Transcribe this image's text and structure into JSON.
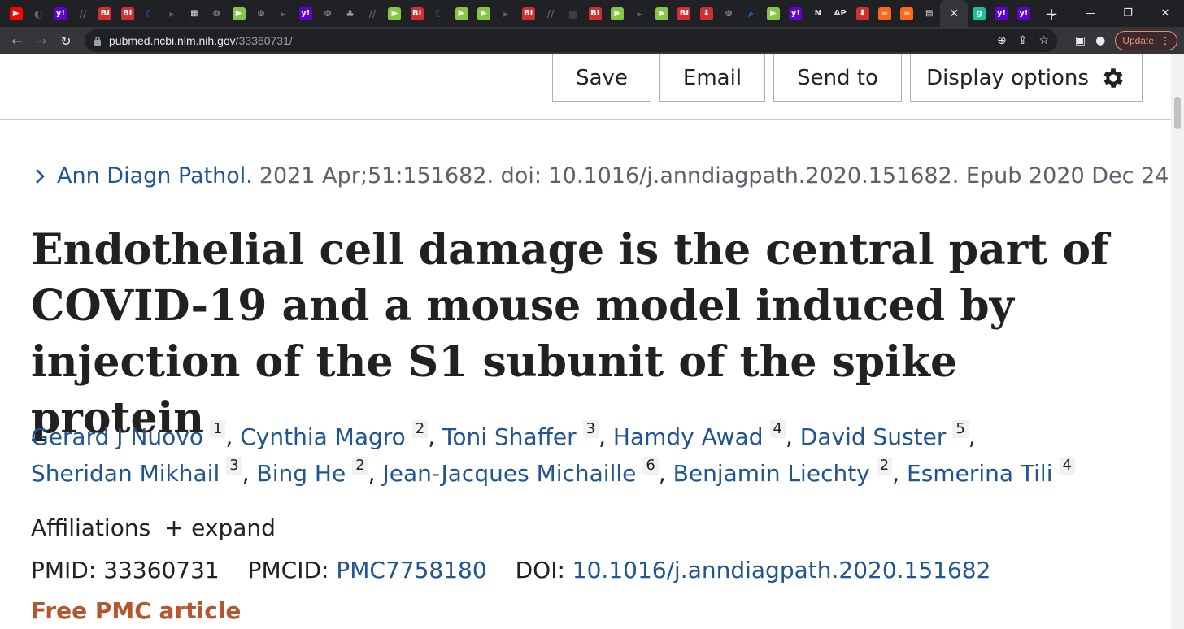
{
  "browser": {
    "tab_favicons": [
      {
        "name": "youtube-icon",
        "color": "#ff0000",
        "glyph": "▶"
      },
      {
        "name": "shield-icon",
        "color": "#5f6368",
        "glyph": "◐"
      },
      {
        "name": "yahoo-icon",
        "color": "#6001d2",
        "glyph": "y!"
      },
      {
        "name": "slashes-icon",
        "color": "#5f6368",
        "glyph": "//"
      },
      {
        "name": "business-insider-icon",
        "color": "#d32f2f",
        "glyph": "BI"
      },
      {
        "name": "business-insider-icon",
        "color": "#d32f2f",
        "glyph": "BI"
      },
      {
        "name": "crescent-icon",
        "color": "#1a73e8",
        "glyph": "☾"
      },
      {
        "name": "arrow-icon",
        "color": "#5f6368",
        "glyph": "▸"
      },
      {
        "name": "grid-icon",
        "color": "#e0e0e0",
        "glyph": "▦"
      },
      {
        "name": "globe-icon",
        "color": "#9aa0a6",
        "glyph": "◍"
      },
      {
        "name": "rumble-icon",
        "color": "#85c742",
        "glyph": "▶"
      },
      {
        "name": "globe-icon",
        "color": "#9aa0a6",
        "glyph": "◍"
      },
      {
        "name": "arrow-icon",
        "color": "#5f6368",
        "glyph": "▸"
      },
      {
        "name": "yahoo-icon",
        "color": "#6001d2",
        "glyph": "y!"
      },
      {
        "name": "globe-icon",
        "color": "#9aa0a6",
        "glyph": "◍"
      },
      {
        "name": "tree-icon",
        "color": "#9aa0a6",
        "glyph": "♣"
      },
      {
        "name": "slashes-icon",
        "color": "#5f6368",
        "glyph": "//"
      },
      {
        "name": "rumble-icon",
        "color": "#85c742",
        "glyph": "▶"
      },
      {
        "name": "business-insider-icon",
        "color": "#d32f2f",
        "glyph": "BI"
      },
      {
        "name": "crescent-icon",
        "color": "#1a73e8",
        "glyph": "☾"
      },
      {
        "name": "rumble-icon",
        "color": "#85c742",
        "glyph": "▶"
      },
      {
        "name": "rumble-icon",
        "color": "#85c742",
        "glyph": "▶"
      },
      {
        "name": "arrow-icon",
        "color": "#5f6368",
        "glyph": "▸"
      },
      {
        "name": "business-insider-icon",
        "color": "#d32f2f",
        "glyph": "BI"
      },
      {
        "name": "slashes-icon",
        "color": "#5f6368",
        "glyph": "//"
      },
      {
        "name": "dark-icon",
        "color": "#3c4043",
        "glyph": "■"
      },
      {
        "name": "business-insider-icon",
        "color": "#d32f2f",
        "glyph": "BI"
      },
      {
        "name": "rumble-icon",
        "color": "#85c742",
        "glyph": "▶"
      },
      {
        "name": "arrow-icon",
        "color": "#5f6368",
        "glyph": "▸"
      },
      {
        "name": "rumble-icon",
        "color": "#85c742",
        "glyph": "▶"
      },
      {
        "name": "business-insider-icon",
        "color": "#d32f2f",
        "glyph": "BI"
      },
      {
        "name": "download-icon",
        "color": "#d32f2f",
        "glyph": "⬇"
      },
      {
        "name": "globe-icon",
        "color": "#9aa0a6",
        "glyph": "◍"
      },
      {
        "name": "search-icon",
        "color": "#1a73e8",
        "glyph": "⌕"
      },
      {
        "name": "rumble-icon",
        "color": "#85c742",
        "glyph": "▶"
      },
      {
        "name": "yahoo-icon",
        "color": "#6001d2",
        "glyph": "y!"
      },
      {
        "name": "news-icon",
        "color": "#e0e0e0",
        "glyph": "N"
      },
      {
        "name": "ap-icon",
        "color": "#e0e0e0",
        "glyph": "AP"
      },
      {
        "name": "download-icon",
        "color": "#d32f2f",
        "glyph": "⬇"
      },
      {
        "name": "substack-icon",
        "color": "#ff6719",
        "glyph": "≡"
      },
      {
        "name": "substack-icon",
        "color": "#ff6719",
        "glyph": "≡"
      },
      {
        "name": "pubmed-icon",
        "color": "#e0e0e0",
        "glyph": "▤"
      }
    ],
    "tabs_after_active": [
      {
        "name": "grammarly-icon",
        "color": "#15c39a",
        "glyph": "g"
      },
      {
        "name": "yahoo-icon",
        "color": "#6001d2",
        "glyph": "y!"
      },
      {
        "name": "yahoo-icon",
        "color": "#6001d2",
        "glyph": "y!"
      }
    ],
    "active_tab_close": "✕",
    "new_tab": "+",
    "url_host": "pubmed.ncbi.nlm.nih.gov",
    "url_path": "/33360731/",
    "update_label": "Update",
    "update_menu": "⋮"
  },
  "actions": {
    "save": "Save",
    "email": "Email",
    "send_to": "Send to",
    "display_options": "Display options"
  },
  "citation": {
    "journal": "Ann Diagn Pathol.",
    "details": "2021 Apr;51:151682. doi: 10.1016/j.anndiagpath.2020.151682. Epub 2020 Dec 24."
  },
  "article": {
    "title": "Endothelial cell damage is the central part of COVID-19 and a mouse model induced by injection of the S1 subunit of the spike protein"
  },
  "authors": [
    {
      "name": "Gerard J Nuovo",
      "aff": "1"
    },
    {
      "name": "Cynthia Magro",
      "aff": "2"
    },
    {
      "name": "Toni Shaffer",
      "aff": "3"
    },
    {
      "name": "Hamdy Awad",
      "aff": "4"
    },
    {
      "name": "David Suster",
      "aff": "5"
    },
    {
      "name": "Sheridan Mikhail",
      "aff": "3"
    },
    {
      "name": "Bing He",
      "aff": "2"
    },
    {
      "name": "Jean-Jacques Michaille",
      "aff": "6"
    },
    {
      "name": "Benjamin Liechty",
      "aff": "2"
    },
    {
      "name": "Esmerina Tili",
      "aff": "4"
    }
  ],
  "affiliations": {
    "label": "Affiliations",
    "expand": "expand"
  },
  "ids": {
    "pmid_label": "PMID:",
    "pmid": "33360731",
    "pmcid_label": "PMCID:",
    "pmcid": "PMC7758180",
    "doi_label": "DOI:",
    "doi": "10.1016/j.anndiagpath.2020.151682"
  },
  "free_pmc": "Free PMC article",
  "colors": {
    "link": "#205493",
    "accent_free": "#b5572c",
    "chrome_dark": "#202124"
  }
}
